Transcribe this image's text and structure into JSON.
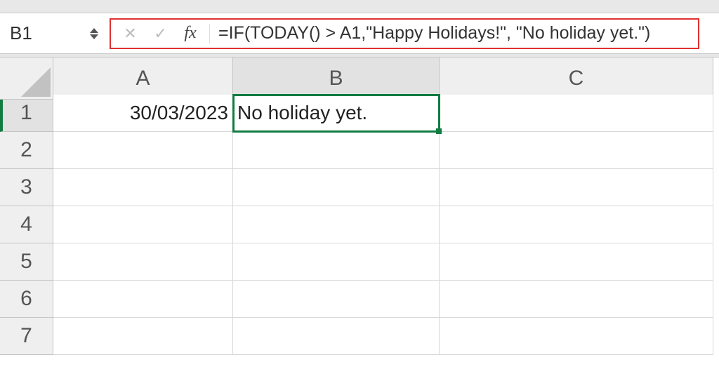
{
  "name_box": "B1",
  "formula": "=IF(TODAY() > A1,\"Happy Holidays!\", \"No holiday yet.\")",
  "fx_label": "fx",
  "columns": [
    "A",
    "B",
    "C"
  ],
  "rows": [
    "1",
    "2",
    "3",
    "4",
    "5",
    "6",
    "7"
  ],
  "active_cell": "B1",
  "cells": {
    "A1": "30/03/2023",
    "B1": "No holiday yet."
  }
}
